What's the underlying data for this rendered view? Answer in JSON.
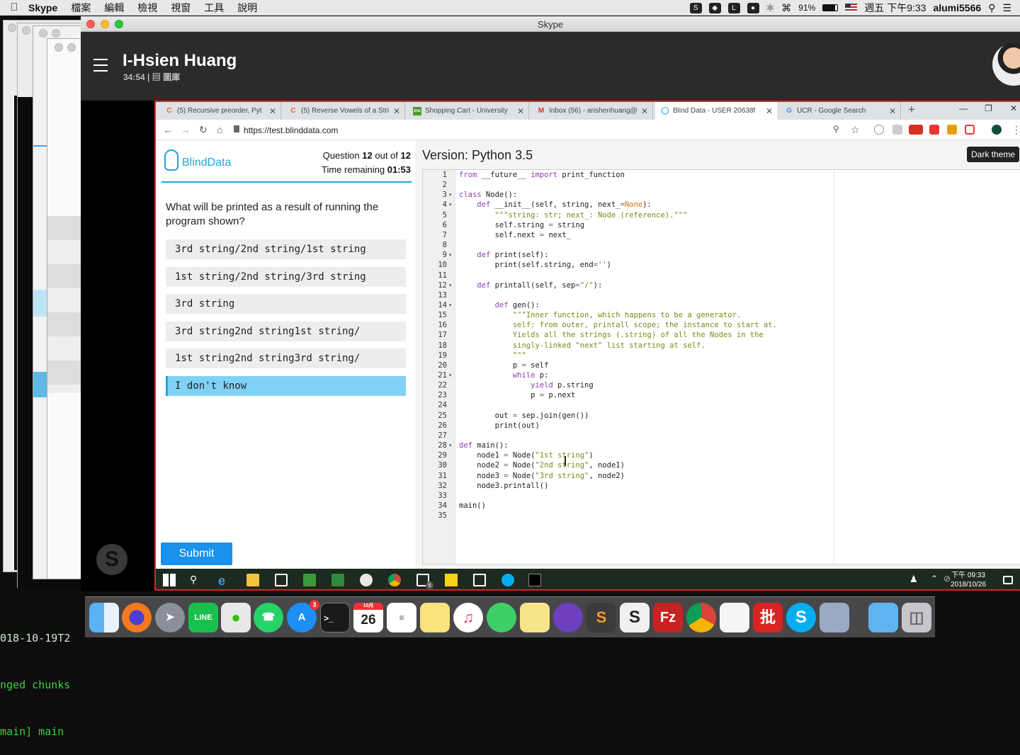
{
  "menubar": {
    "apple_icon": "apple-icon",
    "app_name": "Skype",
    "items": [
      "檔案",
      "編輯",
      "檢視",
      "視窗",
      "工具",
      "說明"
    ],
    "battery": "91%",
    "datetime": "週五 下午9:33",
    "user": "alumi5566"
  },
  "skype": {
    "window_title": "Skype",
    "contact_name": "I-Hsien Huang",
    "call_time": "34:54",
    "call_sub_sep": "|",
    "call_sub_label": "圖庫"
  },
  "chrome": {
    "tabs": [
      {
        "title": "(5) Recursive preorder, Pyt",
        "favicon": "C"
      },
      {
        "title": "(5) Reverse Vowels of a Stri",
        "favicon": "C"
      },
      {
        "title": "Shopping Cart - University",
        "favicon": "znc"
      },
      {
        "title": "Inbox (56) - arishenhuang@",
        "favicon": "M"
      },
      {
        "title": "Blind Data - USER 20638f",
        "favicon": "bulb"
      },
      {
        "title": "UCR - Google Search",
        "favicon": "G"
      }
    ],
    "url": "https://test.blinddata.com"
  },
  "quiz": {
    "logo_text": "BlindData",
    "question_label": "Question",
    "question_num": "12",
    "question_of": "out of",
    "question_total": "12",
    "time_label": "Time remaining",
    "time_value": "01:53",
    "question_text": "What will be printed as a result of running the program shown?",
    "options": [
      "3rd string/2nd string/1st string",
      "1st string/2nd string/3rd string",
      "3rd string",
      "3rd string2nd string1st string/",
      "1st string2nd string3rd string/",
      "I don't know"
    ],
    "selected_option": 5,
    "submit_label": "Submit"
  },
  "code": {
    "version_label": "Version: Python 3.5",
    "theme_tooltip": "Dark theme",
    "line_numbers": [
      "1",
      "2",
      "3",
      "4",
      "5",
      "6",
      "7",
      "8",
      "9",
      "10",
      "11",
      "12",
      "13",
      "14",
      "15",
      "16",
      "17",
      "18",
      "19",
      "20",
      "21",
      "22",
      "23",
      "24",
      "25",
      "26",
      "27",
      "28",
      "29",
      "30",
      "31",
      "32",
      "33",
      "34",
      "35"
    ],
    "lines": [
      "from __future__ import print_function",
      "",
      "class Node():",
      "    def __init__(self, string, next_=None):",
      "        \"\"\"string: str; next_: Node (reference).\"\"\"",
      "        self.string = string",
      "        self.next = next_",
      "",
      "    def print(self):",
      "        print(self.string, end='')",
      "",
      "    def printall(self, sep=\"/\"):",
      "",
      "        def gen():",
      "            \"\"\"Inner function, which happens to be a generator.",
      "            self: from outer, printall scope; the instance to start at.",
      "            Yields all the strings (.string) of all the Nodes in the",
      "            singly-linked \"next\" list starting at self.",
      "            \"\"\"",
      "            p = self",
      "            while p:",
      "                yield p.string",
      "                p = p.next",
      "",
      "        out = sep.join(gen())",
      "        print(out)",
      "",
      "def main():",
      "    node1 = Node(\"1st string\")",
      "    node2 = Node(\"2nd string\", node1)",
      "    node3 = Node(\"3rd string\", node2)",
      "    node3.printall()",
      "",
      "main()",
      ""
    ]
  },
  "taskbar": {
    "clock_time": "下午 09:33",
    "clock_date": "2018/10/26",
    "mail_badge": "6"
  },
  "terminal": {
    "line1": "018-10-19T2",
    "line2": "nged chunks",
    "line3": "main] main"
  },
  "dock": {
    "icons": [
      "finder-icon",
      "firefox-icon",
      "launchpad-icon",
      "line-icon",
      "wechat-icon",
      "whatsapp-icon",
      "app-store-icon",
      "terminal-icon",
      "calendar-icon",
      "reminders-icon",
      "notes-icon",
      "itunes-icon",
      "messages-icon",
      "stickies-icon",
      "github-icon",
      "sublime-icon",
      "slides-icon",
      "filezilla-icon",
      "chrome-icon",
      "textedit-icon",
      "pi-icon",
      "skype-icon",
      "preview-icon",
      "folder-icon",
      "trash-icon"
    ],
    "calendar_day": "26",
    "calendar_month": "10月",
    "app_store_badge": "3"
  }
}
